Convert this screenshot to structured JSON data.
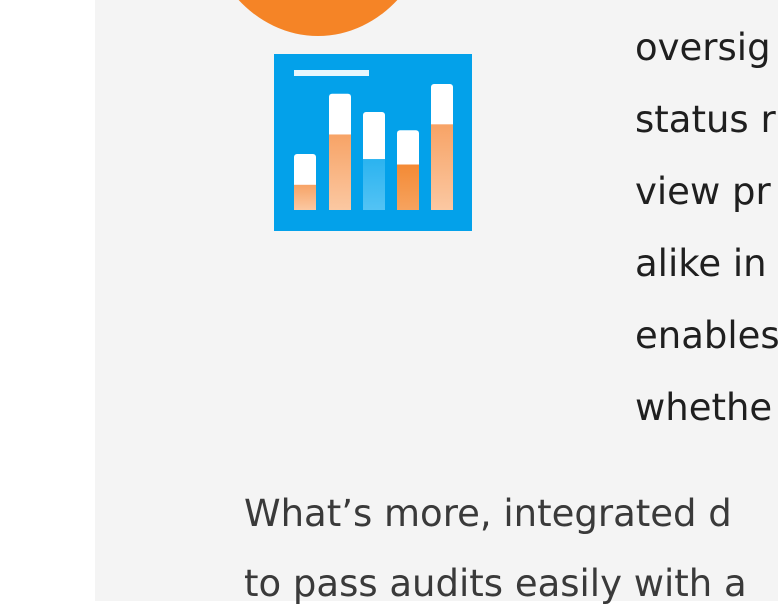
{
  "colors": {
    "page_bg": "#f4f4f4",
    "outer_bg": "#ffffff",
    "accent_orange": "#f58426",
    "icon_blue": "#03a1ea",
    "bar_light_orange": "#f7ad75",
    "bar_orange": "#f48a35",
    "bar_blue": "#1faeee",
    "text_dark": "#1f1f1f"
  },
  "icons": {
    "top_circle": "orange-circle-icon",
    "chart": "bar-chart-icon"
  },
  "chart_icon_levels": [
    0.4,
    0.83,
    0.7,
    0.57,
    0.9
  ],
  "right_column_lines": [
    "oversig",
    "status r",
    "view pr",
    "alike in",
    "enables",
    "whethe"
  ],
  "paragraph_lines": [
    "What’s more, integrated d",
    "to pass audits easily with a"
  ]
}
